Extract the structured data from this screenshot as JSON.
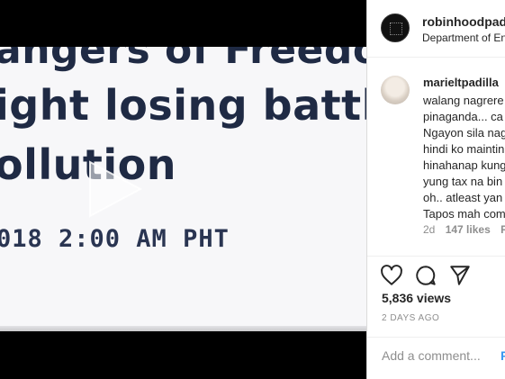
{
  "video": {
    "headline_line1": "angers of Freedom",
    "headline_line2": "ight losing battle vs",
    "headline_line3": "ollution",
    "timeline": "018 2:00 AM PHT"
  },
  "post": {
    "username": "robinhoodpadil",
    "location": "Department of En"
  },
  "comment": {
    "username": "marieltpadilla",
    "lines": [
      "walang nagrere",
      "pinaganda... ca",
      "Ngayon sila nag",
      "hindi ko maintin",
      "hinahanap kung",
      "yung tax na bin",
      "oh.. atleast yan",
      "Tapos mah com"
    ],
    "age": "2d",
    "likes": "147 likes",
    "reply": "R"
  },
  "actions": {
    "icons": [
      "heart-icon",
      "comment-icon",
      "share-icon"
    ],
    "views": "5,836 views",
    "posted": "2 DAYS AGO"
  },
  "add_comment": {
    "placeholder": "Add a comment...",
    "post_label": "P"
  }
}
